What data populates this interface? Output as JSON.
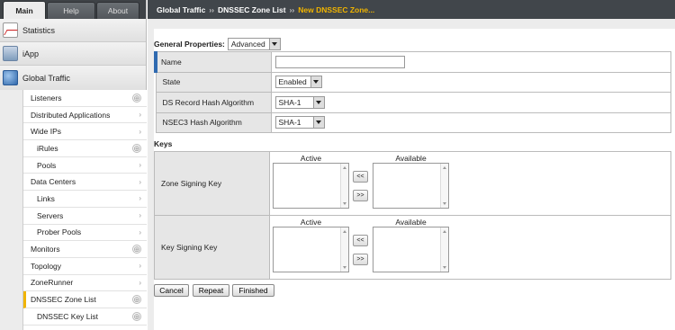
{
  "tabs": [
    {
      "label": "Main"
    },
    {
      "label": "Help"
    },
    {
      "label": "About"
    }
  ],
  "panes": {
    "statistics": "Statistics",
    "iapp": "iApp",
    "global_traffic": "Global Traffic"
  },
  "nav": [
    {
      "label": "Listeners",
      "ctrl": "plus"
    },
    {
      "label": "Distributed Applications",
      "ctrl": "chev"
    },
    {
      "label": "Wide IPs",
      "ctrl": "chev"
    },
    {
      "label": "iRules",
      "ctrl": "plus"
    },
    {
      "label": "Pools",
      "ctrl": "chev"
    },
    {
      "label": "Data Centers",
      "ctrl": "chev"
    },
    {
      "label": "Links",
      "ctrl": "chev"
    },
    {
      "label": "Servers",
      "ctrl": "chev"
    },
    {
      "label": "Prober Pools",
      "ctrl": "chev"
    },
    {
      "label": "Monitors",
      "ctrl": "plus"
    },
    {
      "label": "Topology",
      "ctrl": "chev"
    },
    {
      "label": "ZoneRunner",
      "ctrl": "chev"
    },
    {
      "label": "DNSSEC Zone List",
      "ctrl": "plus"
    },
    {
      "label": "DNSSEC Key List",
      "ctrl": "plus"
    }
  ],
  "nav_icons": {
    "plus": "⊕",
    "chev": "›"
  },
  "breadcrumb": {
    "a": "Global Traffic",
    "b": "DNSSEC Zone List",
    "c": "New DNSSEC Zone...",
    "sep": "››"
  },
  "general": {
    "label": "General Properties:",
    "mode": "Advanced"
  },
  "props": {
    "name_label": "Name",
    "name_value": "",
    "state_label": "State",
    "state_value": "Enabled",
    "ds_label": "DS Record Hash Algorithm",
    "ds_value": "SHA-1",
    "nsec3_label": "NSEC3 Hash Algorithm",
    "nsec3_value": "SHA-1"
  },
  "keys": {
    "section": "Keys",
    "zsk_label": "Zone Signing Key",
    "ksk_label": "Key Signing Key",
    "active": "Active",
    "available": "Available",
    "move_left": "<<",
    "move_right": ">>"
  },
  "buttons": {
    "cancel": "Cancel",
    "repeat": "Repeat",
    "finished": "Finished"
  },
  "colors": {
    "accent": "#f0b400",
    "header_bg": "#41464b",
    "selected_marker": "#2f6ab0"
  }
}
